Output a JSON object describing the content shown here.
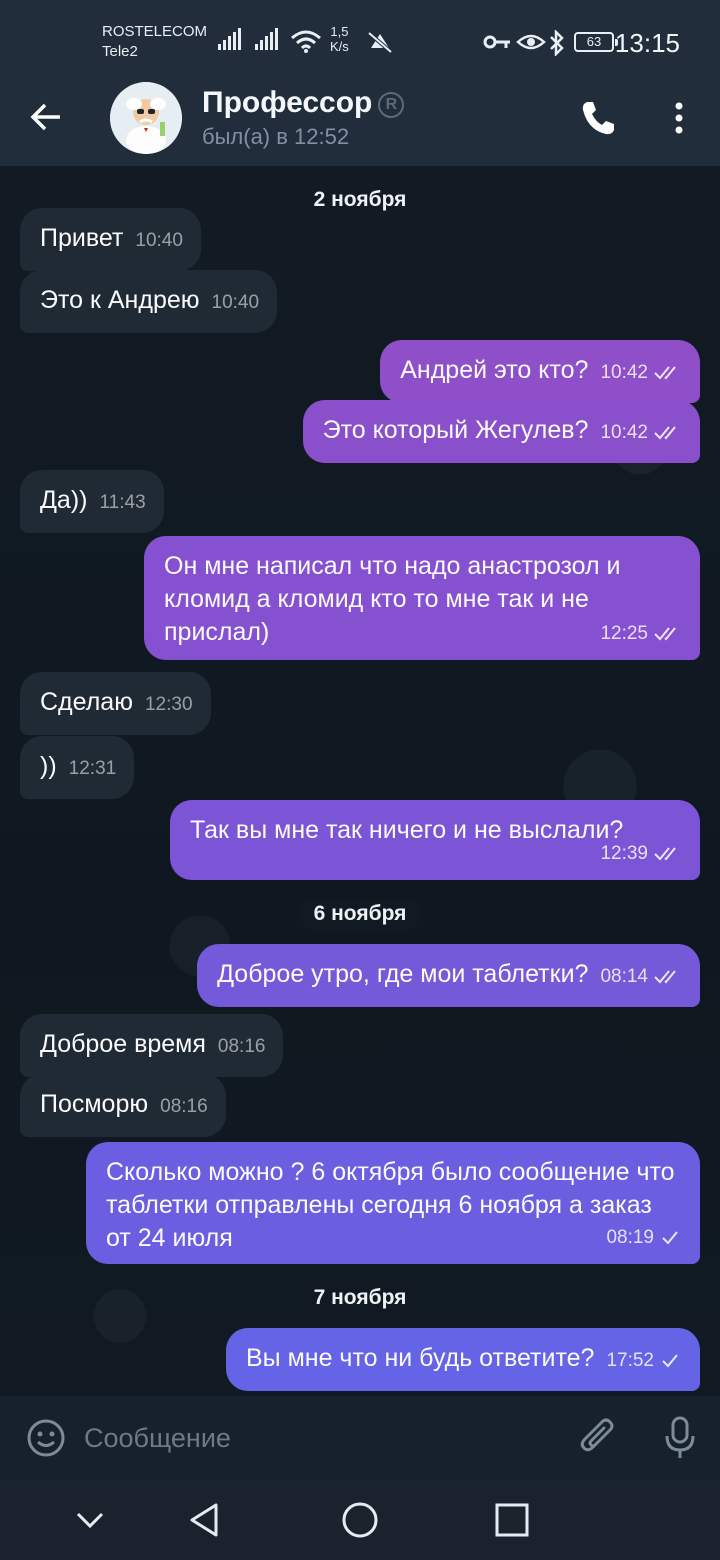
{
  "status_bar": {
    "carrier_1": "ROSTELECOM",
    "carrier_2": "Tele2",
    "speed_value": "1,5",
    "speed_unit": "K/s",
    "battery": "63",
    "time": "13:15",
    "icons": [
      "signal-icon",
      "signal-icon",
      "wifi-icon",
      "mute-icon",
      "key-icon",
      "eye-icon",
      "bluetooth-icon",
      "battery-icon"
    ]
  },
  "header": {
    "title": "Профессор",
    "verified_mark": "R",
    "subtitle": "был(а) в 12:52",
    "icons": [
      "back-arrow-icon",
      "phone-icon",
      "more-vertical-icon"
    ]
  },
  "dates": [
    "2 ноября",
    "6 ноября",
    "7 ноября"
  ],
  "messages": [
    {
      "dir": "in",
      "text": "Привет",
      "time": "10:40"
    },
    {
      "dir": "in",
      "text": "Это к Андрею",
      "time": "10:40"
    },
    {
      "dir": "out",
      "text": "Андрей это кто?",
      "time": "10:42",
      "status": "read"
    },
    {
      "dir": "out",
      "text": "Это который Жегулев?",
      "time": "10:42",
      "status": "read"
    },
    {
      "dir": "in",
      "text": "Да))",
      "time": "11:43"
    },
    {
      "dir": "out",
      "text": "Он мне написал что надо анастрозол и кломид  а кломид кто то мне так и не прислал)",
      "time": "12:25",
      "status": "read"
    },
    {
      "dir": "in",
      "text": "Сделаю",
      "time": "12:30"
    },
    {
      "dir": "in",
      "text": "))",
      "time": "12:31"
    },
    {
      "dir": "out",
      "text": "Так вы мне так ничего и не выслали?",
      "time": "12:39",
      "status": "read"
    },
    {
      "dir": "out",
      "text": "Доброе утро, где мои таблетки?",
      "time": "08:14",
      "status": "read"
    },
    {
      "dir": "in",
      "text": "Доброе время",
      "time": "08:16"
    },
    {
      "dir": "in",
      "text": "Посморю",
      "time": "08:16"
    },
    {
      "dir": "out",
      "text": "Сколько можно ?  6 октября было сообщение что таблетки отправлены сегодня 6 ноября а заказ от 24 июля",
      "time": "08:19",
      "status": "sent"
    },
    {
      "dir": "out",
      "text": "Вы мне что ни будь ответите?",
      "time": "17:52",
      "status": "sent"
    }
  ],
  "colors": {
    "out_bubble_top": "#8e4fc9",
    "out_bubble_bottom": "#5f6ee8",
    "in_bubble": "#1f2a35",
    "header_bg": "#212d3b"
  },
  "input": {
    "placeholder": "Сообщение",
    "icons": [
      "emoji-icon",
      "attach-icon",
      "microphone-icon"
    ]
  },
  "navbar": {
    "icons": [
      "chevron-down-icon",
      "back-triangle-icon",
      "home-circle-icon",
      "recents-square-icon"
    ]
  }
}
